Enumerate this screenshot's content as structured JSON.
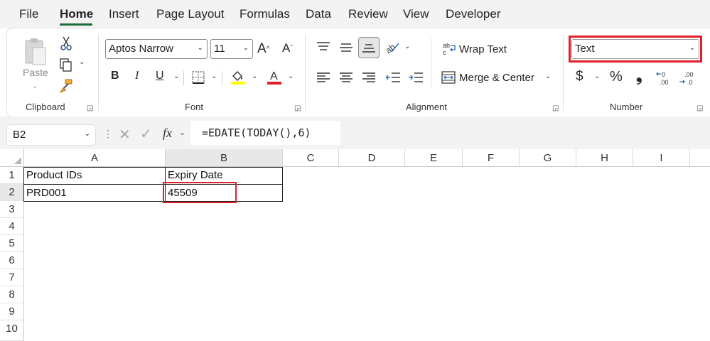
{
  "tabs": [
    "File",
    "Home",
    "Insert",
    "Page Layout",
    "Formulas",
    "Data",
    "Review",
    "View",
    "Developer"
  ],
  "active_tab": "Home",
  "clipboard": {
    "paste_label": "Paste",
    "group_label": "Clipboard"
  },
  "font": {
    "name": "Aptos Narrow",
    "size": "11",
    "group_label": "Font",
    "bold": "B",
    "italic": "I",
    "underline": "U"
  },
  "alignment": {
    "wrap_text": "Wrap Text",
    "merge_center": "Merge & Center",
    "group_label": "Alignment"
  },
  "number": {
    "format": "Text",
    "currency_symbol": "$",
    "percent_symbol": "%",
    "comma_symbol": "❟",
    "group_label": "Number"
  },
  "formula_bar": {
    "name_box": "B2",
    "fx": "fx",
    "formula": "=EDATE(TODAY(),6)"
  },
  "columns": [
    "A",
    "B",
    "C",
    "D",
    "E",
    "F",
    "G",
    "H",
    "I"
  ],
  "rows": [
    "1",
    "2",
    "3",
    "4",
    "5",
    "6",
    "7",
    "8",
    "9",
    "10"
  ],
  "cells": {
    "A1": "Product IDs",
    "B1": "Expiry Date",
    "A2": "PRD001",
    "B2": "45509"
  },
  "colors": {
    "accent_green": "#1a6b35",
    "highlight_red": "#e01f2a",
    "font_color_red": "#e01f2a",
    "fill_yellow": "#ffff00"
  }
}
